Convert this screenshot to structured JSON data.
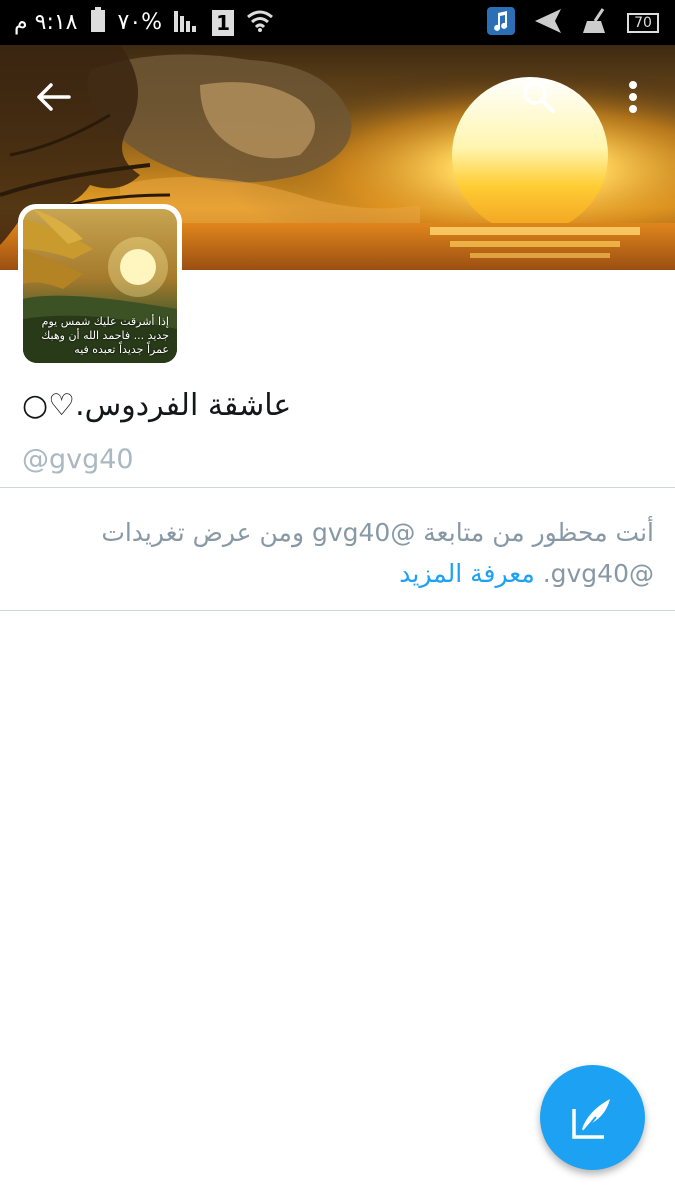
{
  "status_bar": {
    "time": "٩:١٨ م",
    "battery_percent": "%٧٠",
    "sim_slot": "1",
    "battery_badge": "70",
    "icons": [
      "battery-icon",
      "signal-icon",
      "sim-icon",
      "wifi-icon",
      "music-app-icon",
      "send-icon",
      "cleaner-icon",
      "battery-saver-icon"
    ]
  },
  "header": {
    "back_icon": "arrow-left-icon",
    "search_icon": "search-icon",
    "menu_icon": "overflow-menu-icon"
  },
  "avatar": {
    "caption": "إذا أشرقت عليك شمس يوم جديد ... فاحمد الله أن وهبك عمراً جديداً تعبده فيه"
  },
  "profile": {
    "display_name": "عاشقة الفردوس.♡○",
    "handle": "@gvg40"
  },
  "blocked_notice": {
    "text": "أنت محظور من متابعة @gvg40 ومن عرض تغريدات @gvg40.",
    "learn_more": "معرفة المزيد"
  },
  "fab": {
    "icon": "compose-tweet-icon"
  },
  "colors": {
    "accent": "#1da1f2",
    "status_bar_bg": "#000000",
    "secondary_text": "#8899a6",
    "handle_text": "#aab8c2",
    "divider": "#ccd6dd"
  }
}
